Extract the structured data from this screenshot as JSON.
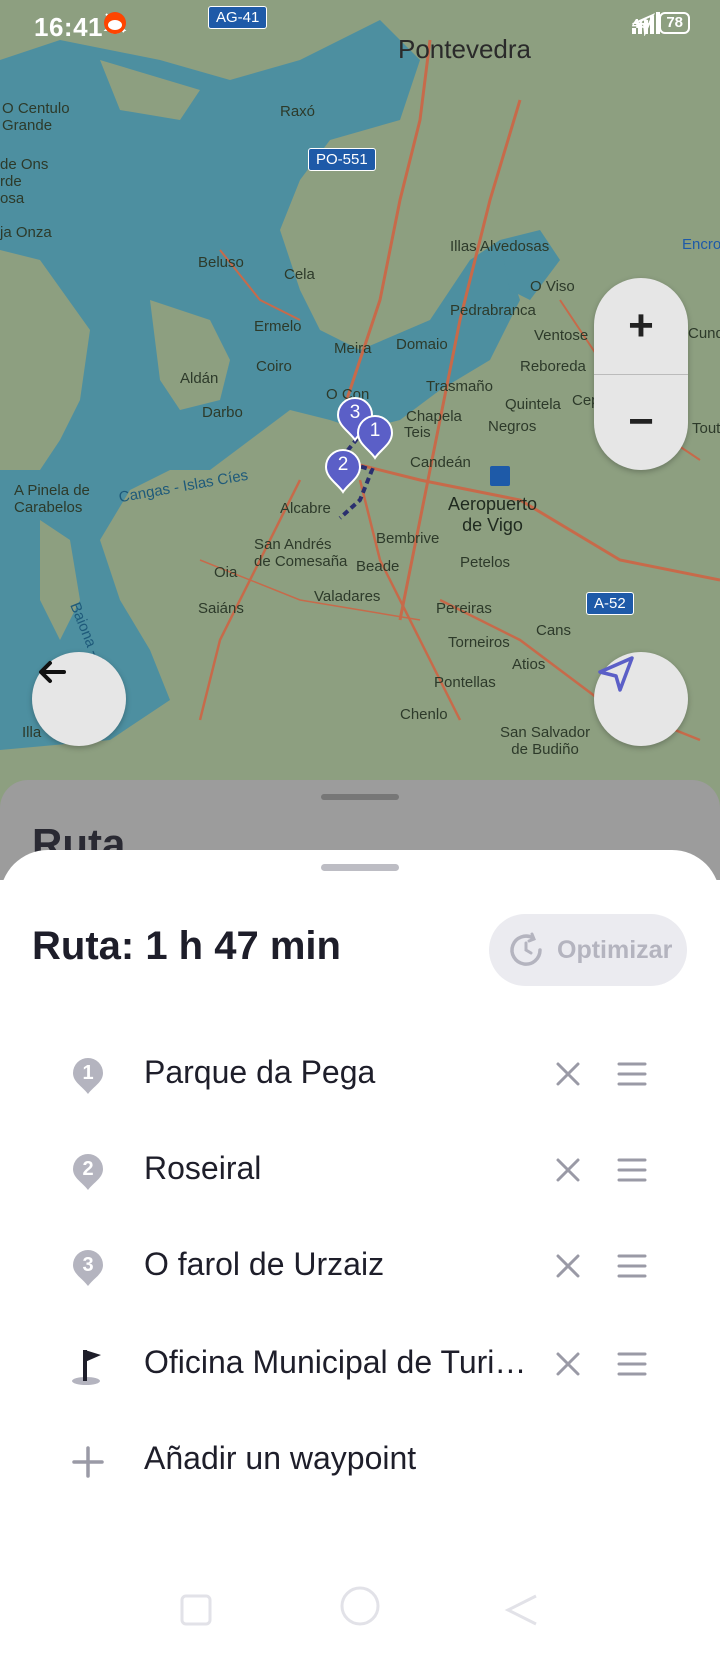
{
  "status_bar": {
    "time": "16:41",
    "network": "4G",
    "battery": "78"
  },
  "map": {
    "labels": {
      "pontevedra": "Pontevedra",
      "o_centulo": "O Centulo\nGrande",
      "de_ons": "de Ons\nrde\nosa",
      "raxo": "Raxó",
      "ja_onza": "ja Onza",
      "beluso": "Beluso",
      "cela": "Cela",
      "illas": "Illas Alvedosas",
      "encro": "Encro",
      "o_viso": "O Viso",
      "pedrabranca": "Pedrabranca",
      "ventose": "Ventose",
      "cunq": "Cunq",
      "ermelo": "Ermelo",
      "meira": "Meira",
      "domaio": "Domaio",
      "reboreda": "Reboreda",
      "aldan": "Aldán",
      "coiro": "Coiro",
      "o_con": "O Con",
      "trasmano": "Trasmaño",
      "quintela": "Quintela",
      "cep": "Cep",
      "darbo": "Darbo",
      "chapela": "Chapela",
      "teis": "Teis",
      "negros": "Negros",
      "tout": "Tout",
      "candean": "Candeán",
      "cangas": "Cangas - Islas Cíes",
      "a_pinela": "A Pinela de\nCarabelos",
      "alcabre": "Alcabre",
      "aeropuerto": "Aeropuerto\nde Vigo",
      "bembrive": "Bembrive",
      "san_andres": "San Andrés\nde Comesaña",
      "beade": "Beade",
      "petelos": "Petelos",
      "oia": "Oia",
      "baiona": "Baiona - Illas Cíes",
      "saians": "Saiáns",
      "valadares": "Valadares",
      "pereiras": "Pereiras",
      "cans": "Cans",
      "torneiros": "Torneiros",
      "atios": "Atios",
      "pontellas": "Pontellas",
      "chenlo": "Chenlo",
      "san_salvador": "San Salvador\nde Budiño",
      "illa": "Illa"
    },
    "roads": {
      "ag41": "AG-41",
      "po551": "PO-551",
      "a52": "A-52"
    },
    "markers": [
      "1",
      "2",
      "3"
    ]
  },
  "controls": {
    "zoom_in": "+",
    "zoom_out": "−"
  },
  "sheet_back_title": "Ruta",
  "route": {
    "title": "Ruta: 1 h 47 min",
    "optimize_label": "Optimizar",
    "waypoints": [
      {
        "number": "1",
        "label": "Parque da Pega"
      },
      {
        "number": "2",
        "label": "Roseiral"
      },
      {
        "number": "3",
        "label": "O farol de Urzaiz"
      },
      {
        "number": "",
        "label": "Oficina Municipal de Turismo"
      }
    ],
    "add_label": "Añadir un waypoint"
  },
  "colors": {
    "accent": "#5b5fc7",
    "text": "#1e1e2a",
    "muted": "#b4b4bf",
    "water": "#4d8fa0",
    "land": "#8d9f80"
  }
}
